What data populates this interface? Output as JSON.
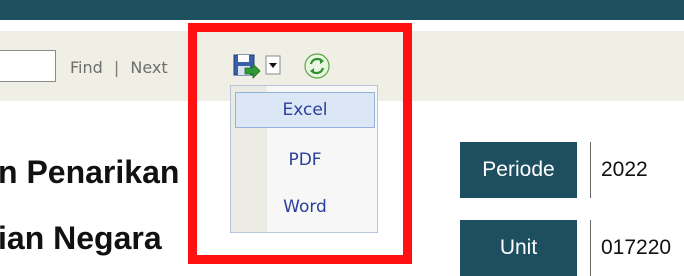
{
  "toolbar": {
    "find_input_value": "",
    "find_label": "Find",
    "separator": "|",
    "next_label": "Next"
  },
  "export_menu": {
    "items": [
      {
        "label": "Excel",
        "hovered": true
      },
      {
        "label": "PDF"
      },
      {
        "label": "Word"
      }
    ]
  },
  "report": {
    "title_line1": "n Penarikan",
    "title_line2": "ian Negara"
  },
  "parameters": [
    {
      "label": "Periode",
      "value": "2022"
    },
    {
      "label": "Unit",
      "value": "017220"
    }
  ],
  "colors": {
    "header": "#1e4f61",
    "toolbar": "#efefe5",
    "highlight": "#ff1111",
    "menu_text": "#2a3f9a"
  },
  "icons": {
    "export": "save-disk-icon",
    "refresh": "refresh-icon"
  }
}
